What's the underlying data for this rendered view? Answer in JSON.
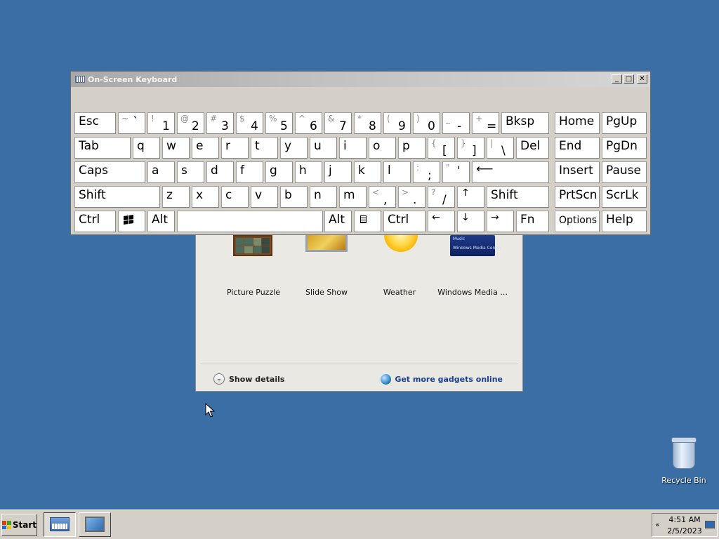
{
  "gallery": {
    "gadgets": [
      {
        "label": "Picture Puzzle",
        "icon": "picture-puzzle-icon"
      },
      {
        "label": "Slide Show",
        "icon": "slide-show-icon"
      },
      {
        "label": "Weather",
        "icon": "weather-icon"
      },
      {
        "label": "Windows Media ...",
        "icon": "windows-media-icon"
      }
    ],
    "wmp_thumb_line1": "Music",
    "wmp_thumb_line2": "Windows Media Center",
    "show_details": "Show details",
    "get_more": "Get more gadgets online"
  },
  "osk": {
    "title": "On-Screen Keyboard",
    "buttons": {
      "minimize": "_",
      "maximize": "□",
      "close": "✕"
    },
    "keys": {
      "esc": "Esc",
      "tilde": {
        "sym": "~",
        "main": "`"
      },
      "k1": {
        "sym": "!",
        "main": "1"
      },
      "k2": {
        "sym": "@",
        "main": "2"
      },
      "k3": {
        "sym": "#",
        "main": "3"
      },
      "k4": {
        "sym": "$",
        "main": "4"
      },
      "k5": {
        "sym": "%",
        "main": "5"
      },
      "k6": {
        "sym": "^",
        "main": "6"
      },
      "k7": {
        "sym": "&",
        "main": "7"
      },
      "k8": {
        "sym": "*",
        "main": "8"
      },
      "k9": {
        "sym": "(",
        "main": "9"
      },
      "k0": {
        "sym": ")",
        "main": "0"
      },
      "minus": {
        "sym": "_",
        "main": "-"
      },
      "equals": {
        "sym": "+",
        "main": "="
      },
      "bksp": "Bksp",
      "home": "Home",
      "pgup": "PgUp",
      "tab": "Tab",
      "q": "q",
      "w": "w",
      "e": "e",
      "r": "r",
      "t": "t",
      "y": "y",
      "u": "u",
      "i": "i",
      "o": "o",
      "p": "p",
      "lbracket": {
        "sym": "{",
        "main": "["
      },
      "rbracket": {
        "sym": "}",
        "main": "]"
      },
      "backslash": {
        "sym": "|",
        "main": "\\"
      },
      "del": "Del",
      "end": "End",
      "pgdn": "PgDn",
      "caps": "Caps",
      "a": "a",
      "s": "s",
      "d": "d",
      "f": "f",
      "g": "g",
      "h": "h",
      "j": "j",
      "k": "k",
      "l": "l",
      "semicolon": {
        "sym": ":",
        "main": ";"
      },
      "quote": {
        "sym": "\"",
        "main": "'"
      },
      "enter": "⟵",
      "insert": "Insert",
      "pause": "Pause",
      "shift_left": "Shift",
      "z": "z",
      "x": "x",
      "c": "c",
      "v": "v",
      "b": "b",
      "n": "n",
      "m": "m",
      "comma": {
        "sym": "<",
        "main": ","
      },
      "period": {
        "sym": ">",
        "main": "."
      },
      "slash": {
        "sym": "?",
        "main": "/"
      },
      "up": "↑",
      "shift_right": "Shift",
      "prtscn": "PrtScn",
      "scrlk": "ScrLk",
      "ctrl_left": "Ctrl",
      "alt_left": "Alt",
      "alt_right": "Alt",
      "ctrl_right": "Ctrl",
      "left": "←",
      "down": "↓",
      "right": "→",
      "fn": "Fn",
      "options": "Options",
      "help": "Help"
    }
  },
  "desktop": {
    "recycle_bin": "Recycle Bin"
  },
  "taskbar": {
    "start": "Start",
    "tray_expand": "«",
    "time": "4:51 AM",
    "date": "2/5/2023"
  }
}
